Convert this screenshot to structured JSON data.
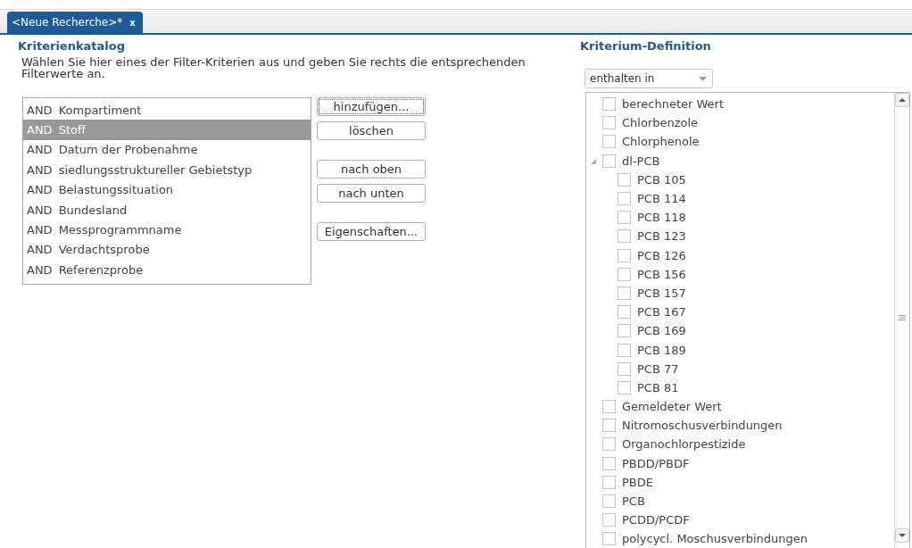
{
  "tabs": [
    {
      "label": "<Neue Recherche>*",
      "close": "x",
      "selected": true
    }
  ],
  "catalog": {
    "title": "Kriterienkatalog",
    "hint": "Wählen Sie hier eines der Filter-Kriterien aus und geben Sie rechts die entsprechenden Filterwerte an.",
    "items": [
      {
        "operator": "AND",
        "label": "Kompartiment",
        "selected": false
      },
      {
        "operator": "AND",
        "label": "Stoff",
        "selected": true
      },
      {
        "operator": "AND",
        "label": "Datum der Probenahme",
        "selected": false
      },
      {
        "operator": "AND",
        "label": "siedlungsstruktureller Gebietstyp",
        "selected": false
      },
      {
        "operator": "AND",
        "label": "Belastungssituation",
        "selected": false
      },
      {
        "operator": "AND",
        "label": "Bundesland",
        "selected": false
      },
      {
        "operator": "AND",
        "label": "Messprogrammname",
        "selected": false
      },
      {
        "operator": "AND",
        "label": "Verdachtsprobe",
        "selected": false
      },
      {
        "operator": "AND",
        "label": "Referenzprobe",
        "selected": false
      }
    ],
    "button_groups": [
      [
        {
          "label": "hinzufügen...",
          "focused": true
        },
        {
          "label": "löschen",
          "focused": false
        }
      ],
      [
        {
          "label": "nach oben",
          "focused": false
        },
        {
          "label": "nach unten",
          "focused": false
        }
      ],
      [
        {
          "label": "Eigenschaften...",
          "focused": false
        }
      ]
    ]
  },
  "definition": {
    "title": "Kriterium-Definition",
    "operator": {
      "value": "enthalten in"
    },
    "tree": [
      {
        "label": "berechneter Wert",
        "checked": false
      },
      {
        "label": "Chlorbenzole",
        "checked": false
      },
      {
        "label": "Chlorphenole",
        "checked": false
      },
      {
        "label": "dl-PCB",
        "checked": false,
        "expanded": true,
        "children": [
          {
            "label": "PCB 105",
            "checked": false
          },
          {
            "label": "PCB 114",
            "checked": false
          },
          {
            "label": "PCB 118",
            "checked": false
          },
          {
            "label": "PCB 123",
            "checked": false
          },
          {
            "label": "PCB 126",
            "checked": false
          },
          {
            "label": "PCB 156",
            "checked": false
          },
          {
            "label": "PCB 157",
            "checked": false
          },
          {
            "label": "PCB 167",
            "checked": false
          },
          {
            "label": "PCB 169",
            "checked": false
          },
          {
            "label": "PCB 189",
            "checked": false
          },
          {
            "label": "PCB 77",
            "checked": false
          },
          {
            "label": "PCB 81",
            "checked": false
          }
        ]
      },
      {
        "label": "Gemeldeter Wert",
        "checked": false
      },
      {
        "label": "Nitromoschusverbindungen",
        "checked": false
      },
      {
        "label": "Organochlorpestizide",
        "checked": false
      },
      {
        "label": "PBDD/PBDF",
        "checked": false
      },
      {
        "label": "PBDE",
        "checked": false
      },
      {
        "label": "PCB",
        "checked": false
      },
      {
        "label": "PCDD/PCDF",
        "checked": false
      },
      {
        "label": "polycycl. Moschusverbindungen",
        "checked": false
      }
    ]
  }
}
